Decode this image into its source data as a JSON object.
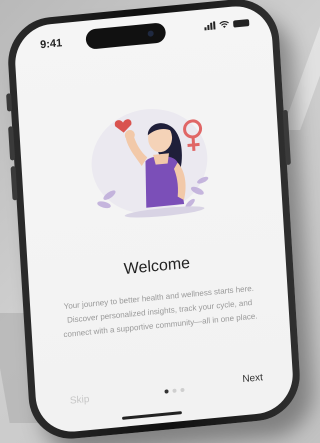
{
  "status_bar": {
    "time": "9:41"
  },
  "onboarding": {
    "title": "Welcome",
    "description": "Your journey to better health and wellness starts here. Discover personalized insights, track your cycle, and connect with a supportive community—all in one place.",
    "illustration": "woman-flexing-arm-with-heart-and-female-symbol"
  },
  "navigation": {
    "skip_label": "Skip",
    "next_label": "Next",
    "page_count": 3,
    "active_page": 1
  },
  "colors": {
    "accent_purple": "#7b4fb8",
    "heart_red": "#d9534f",
    "text_dark": "#222222",
    "text_muted": "#999999"
  }
}
